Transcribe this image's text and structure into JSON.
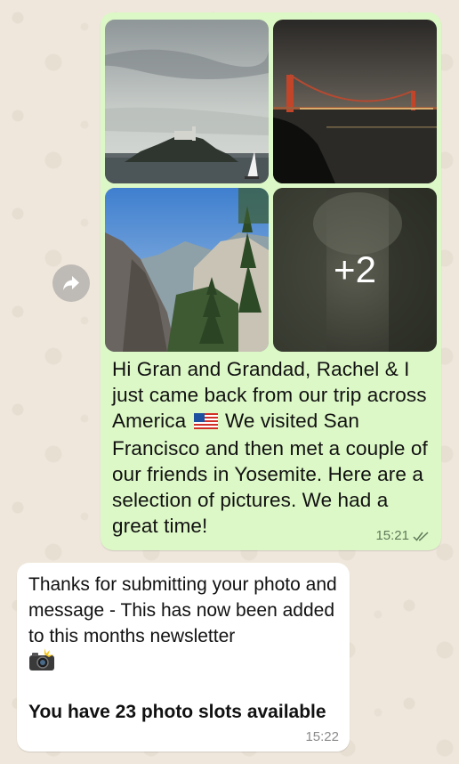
{
  "outgoing_message": {
    "photos": [
      {
        "icon": "photo-alcatraz"
      },
      {
        "icon": "photo-golden-gate-bridge"
      },
      {
        "icon": "photo-yosemite"
      },
      {
        "icon": "photo-more"
      }
    ],
    "more_count": "+2",
    "text_part1": "Hi Gran and Grandad, Rachel & I just came back from our trip across America",
    "flag_icon": "us-flag-emoji",
    "text_part2": "We visited San Francisco and then met a couple of our friends in Yosemite. Here are a selection of pictures. We had a great time!",
    "time": "15:21",
    "status_icon": "double-check-icon",
    "bubble_color": "#dcf8c6"
  },
  "forward_icon": "forward-arrow-icon",
  "incoming_message": {
    "text": "Thanks for submitting your photo and message - This has now been added to this months newsletter",
    "emoji_icon": "camera-flash-emoji",
    "bold_text": "You have 23 photo slots available",
    "time": "15:22",
    "bubble_color": "#ffffff"
  }
}
